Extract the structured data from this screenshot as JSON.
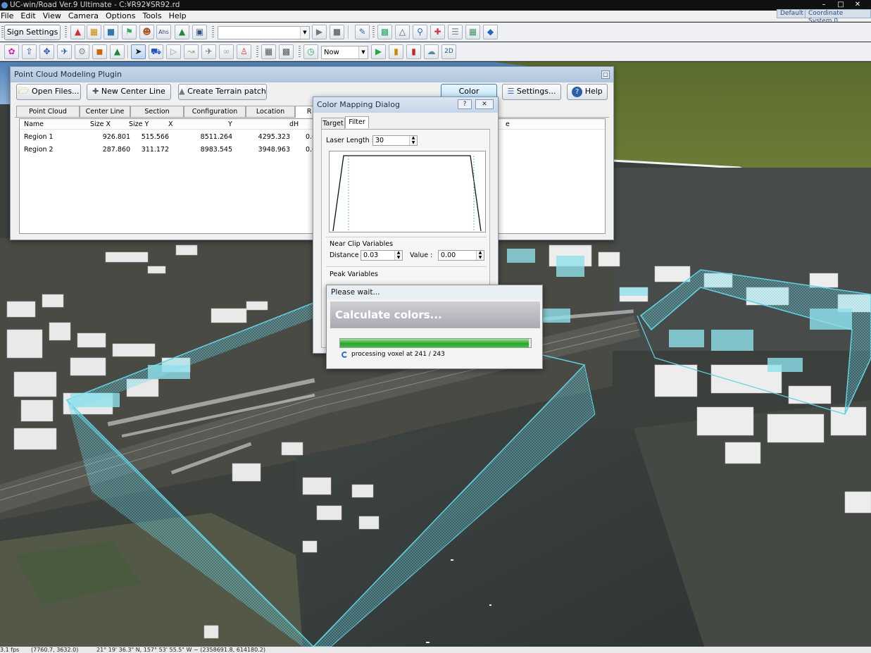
{
  "window": {
    "title": "UC-win/Road Ver.9 Ultimate - C:¥R92¥SR92.rd",
    "controls": [
      "–",
      "□",
      "✕"
    ],
    "tags": [
      "Default",
      "Coordinate System 0"
    ]
  },
  "menu": [
    "File",
    "Edit",
    "View",
    "Camera",
    "Options",
    "Tools",
    "Help"
  ],
  "toolbar": {
    "sign_settings": "Sign Settings",
    "time_combo": "Now",
    "mode_2d": "2D"
  },
  "plugin": {
    "title": "Point Cloud Modeling Plugin",
    "buttons": {
      "open_files": "Open Files...",
      "new_center_line": "New Center Line",
      "create_terrain_patch": "Create Terrain patch",
      "color_mapping": "Color Mapping...",
      "settings": "Settings...",
      "help": "Help"
    },
    "tabs": [
      "Point Cloud",
      "Center Line",
      "Section",
      "Configuration",
      "Location",
      "R"
    ],
    "columns": [
      "Name",
      "Size X",
      "Size Y",
      "X",
      "Y",
      "dH",
      "e"
    ],
    "rows": [
      [
        "Region 1",
        "926.801",
        "515.566",
        "8511.264",
        "4295.323",
        "0.0"
      ],
      [
        "Region 2",
        "287.860",
        "311.172",
        "8983.545",
        "3948.963",
        "0.0"
      ]
    ]
  },
  "color_dialog": {
    "title": "Color Mapping Dialog",
    "tabs": [
      "Target",
      "Filter"
    ],
    "laser_length_label": "Laser Length :",
    "laser_length": "30",
    "near_clip_heading": "Near Clip Variables",
    "distance_label": "Distance :",
    "distance": "0.03",
    "value_label": "Value :",
    "value": "0.00",
    "peak_heading": "Peak Variables"
  },
  "progress": {
    "title": "Please wait...",
    "heading": "Calculate colors...",
    "fraction": 0.99,
    "message": "processing voxel at 241 / 243"
  },
  "status": {
    "fps": "3.1 fps",
    "coords": "(7760.7, 3632.0)",
    "geo": "21° 19' 36.3\" N, 157° 53' 55.5\" W ~ (2358691.8, 614180.2)"
  }
}
